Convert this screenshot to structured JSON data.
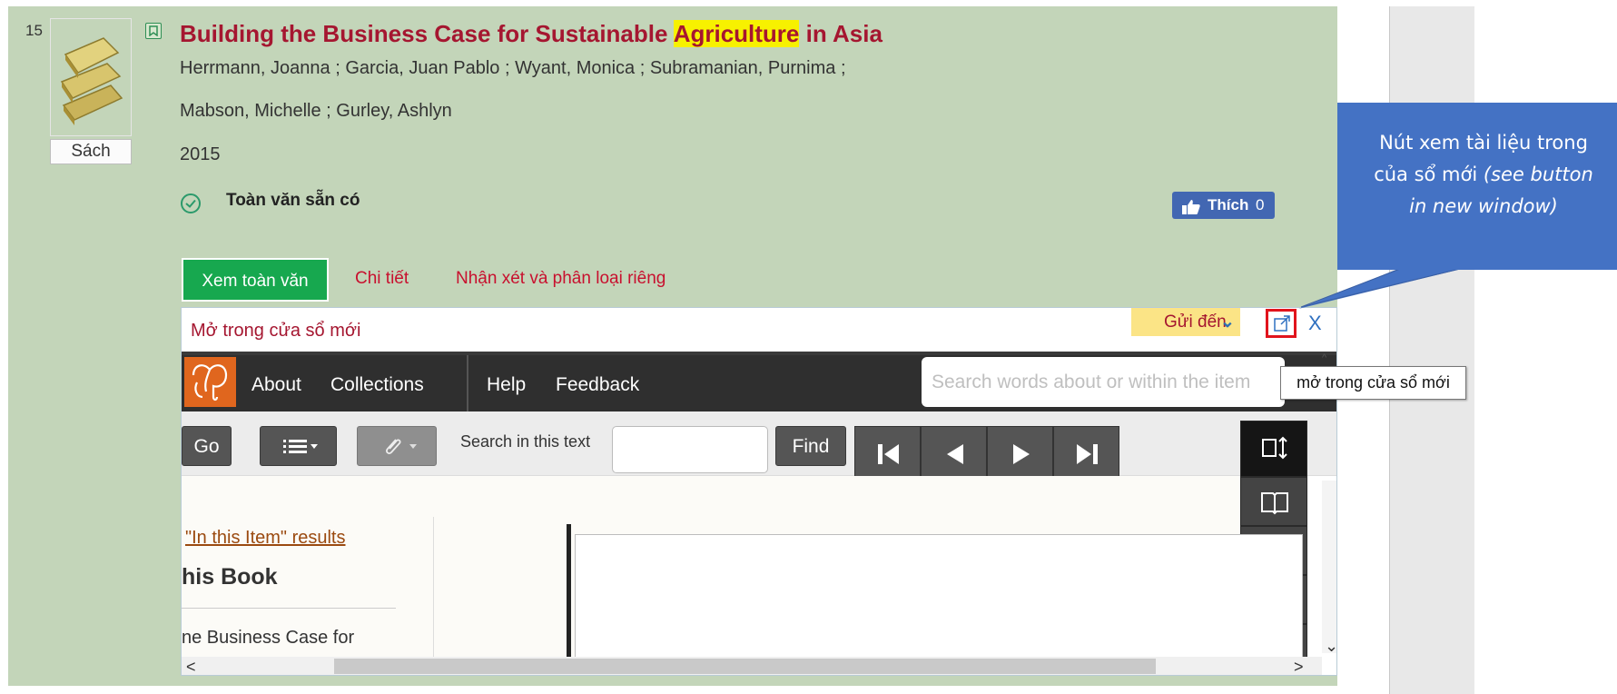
{
  "result": {
    "number": "15",
    "type_label": "Sách",
    "book_icon": "book-stack-icon",
    "bookmark_icon": "bookmark-icon",
    "title_before": "Building the Business Case for Sustainable ",
    "title_highlight": "Agriculture",
    "title_after": " in Asia",
    "authors_line1": "Herrmann, Joanna ; Garcia, Juan Pablo ; Wyant, Monica ; Subramanian, Purnima ;",
    "authors_line2": "Mabson, Michelle ; Gurley, Ashlyn",
    "year": "2015",
    "availability": "Toàn văn sẵn có",
    "availability_icon": "check-circle-icon",
    "like_label": "Thích",
    "like_count": "0",
    "like_icon": "thumbs-up-icon"
  },
  "tabs": {
    "full_text": "Xem toàn văn",
    "details": "Chi tiết",
    "reviews": "Nhận xét và phân loại riêng"
  },
  "viewer": {
    "open_new_label": "Mở trong cửa sổ mới",
    "send_to": "Gửi đến",
    "send_to_chevron": "⌄",
    "external_icon": "external-window-icon",
    "close": "X",
    "logo_icon": "elephant-logo-icon",
    "nav": [
      "About",
      "Collections",
      "Help",
      "Feedback"
    ],
    "search_placeholder": "Search words about or within the item",
    "go": "Go",
    "search_in_text_label": "Search in this text",
    "find": "Find",
    "results_link": "\"In this Item\" results",
    "book_heading": "his Book",
    "book_desc": "ne Business Case for",
    "scroll_left": "<",
    "scroll_right": ">",
    "scroll_down": "⌄",
    "scroll_up": "^"
  },
  "tooltip": "mở trong cửa sổ mới",
  "callout": {
    "line1": "Nút xem tài liệu trong",
    "line2_plain": "của sổ mới ",
    "line2_italic": "(see button",
    "line3_italic": "in new window)"
  },
  "colors": {
    "result_bg": "#c3d5b9",
    "title": "#a51630",
    "highlight": "#f7f100",
    "primary_button": "#17a84f",
    "callout": "#4472c4",
    "external_border": "#e1141c",
    "navbar": "#2f2f2f"
  }
}
